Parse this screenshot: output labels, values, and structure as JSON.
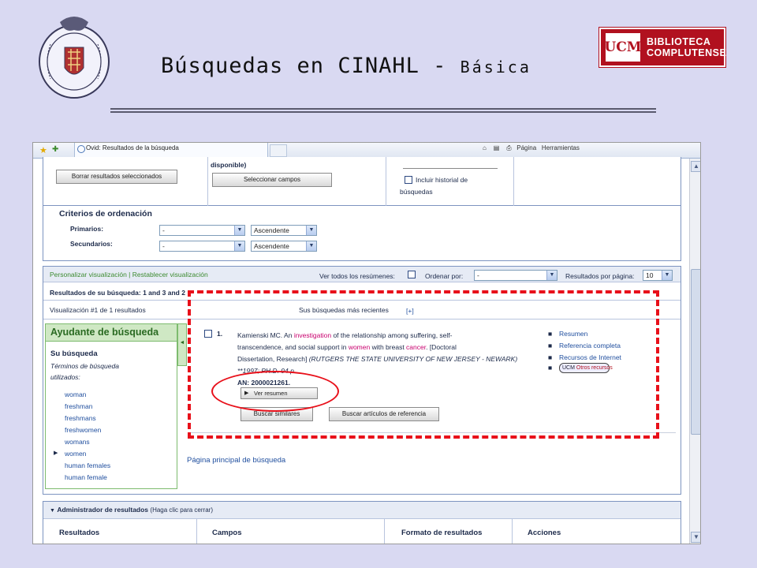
{
  "slide": {
    "title": "Búsquedas en CINAHL - ",
    "subtitle": "Básica",
    "logo_box": "UCM",
    "logo_line1": "BIBLIOTECA",
    "logo_line2": "COMPLUTENSE",
    "accent_color": "#b1111f"
  },
  "browser": {
    "tab_title": "Ovid: Resultados de la búsqueda",
    "toolbar_page": "Página",
    "toolbar_tools": "Herramientas"
  },
  "top_section": {
    "delete_selected_button": "Borrar resultados seleccionados",
    "available_text": "disponible)",
    "select_fields_button": "Seleccionar campos",
    "include_history_line1": "Incluir historial de",
    "include_history_line2": "búsquedas"
  },
  "sort": {
    "heading": "Criterios de ordenación",
    "primary_label": "Primarios:",
    "secondary_label": "Secundarios:",
    "primary_value": "-",
    "primary_order": "Ascendente",
    "secondary_value": "-",
    "secondary_order": "Ascendente"
  },
  "results_bar": {
    "customize_link": "Personalizar visualización",
    "separator": "|",
    "reset_link": "Restablecer visualización",
    "view_all_abstracts": "Ver todos los resúmenes:",
    "sort_by_label": "Ordenar por:",
    "sort_by_value": "-",
    "per_page_label": "Resultados por página:",
    "per_page_value": "10"
  },
  "results_info": {
    "results_of_search": "Resultados de su búsqueda: 1 and 3 and 2",
    "display_info": "Visualización #1 de 1 resultados",
    "recent_searches": "Sus búsquedas más recientes",
    "recent_toggle": "[+]"
  },
  "helper": {
    "title": "Ayudante de búsqueda",
    "your_search": "Su búsqueda",
    "terms_line1": "Términos de búsqueda",
    "terms_line2": "utilizados:",
    "terms": [
      "woman",
      "freshman",
      "freshmans",
      "freshwomen",
      "womans",
      "women",
      "human females",
      "human female"
    ],
    "active_term_index": 5
  },
  "result": {
    "number": "1.",
    "line1_pre": "Kamienski MC. An ",
    "line1_hl": "investigation",
    "line1_post": " of the relationship among suffering, self-",
    "line2_pre": "transcendence, and social support in ",
    "line2_hl1": "women",
    "line2_mid": " with breast ",
    "line2_hl2": "cancer",
    "line2_post": ". [Doctoral",
    "line3_pre": "Dissertation, Research] ",
    "line3_italic": "(RUTGERS THE STATE UNIVERSITY OF NEW JERSEY - NEWARK)",
    "line4": "**1997; PH.D. 94 p.",
    "an": "AN: 2000021261.",
    "view_abstract": "Ver resumen",
    "find_similar": "Buscar similares",
    "find_citing": "Buscar artículos de referencia",
    "links": [
      "Resumen",
      "Referencia completa",
      "Recursos de Internet"
    ],
    "other_resources_prefix": "UCM",
    "other_resources": "Otros recursos"
  },
  "main_search_link": "Página principal de búsqueda",
  "manager": {
    "title": "Administrador de resultados",
    "hint": "(Haga clic para cerrar)",
    "columns": [
      "Resultados",
      "Campos",
      "Formato de resultados",
      "Acciones"
    ]
  }
}
